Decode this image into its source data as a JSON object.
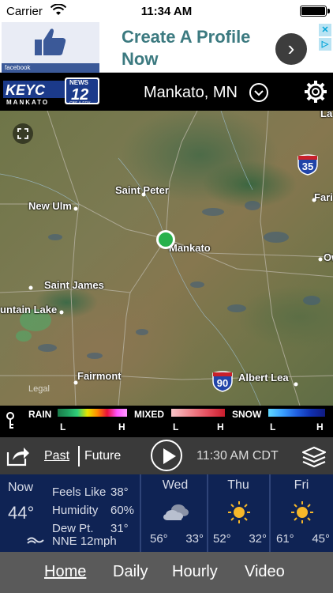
{
  "status_bar": {
    "carrier": "Carrier",
    "time": "11:34 AM"
  },
  "ad": {
    "brand": "facebook",
    "headline": "Create A Profile Now",
    "arrow": "›",
    "adchoices_icon": "adchoices-icon"
  },
  "header": {
    "logo_text": "KEYC",
    "logo_sub": "MANKATO",
    "logo_news": "NEWS",
    "logo_channel": "12",
    "logo_network": "CBS & FOX",
    "location": "Mankato, MN"
  },
  "map": {
    "labels": {
      "saint_peter": "Saint Peter",
      "new_ulm": "New Ulm",
      "mankato": "Mankato",
      "saint_james": "Saint James",
      "fountain_lake": "untain Lake",
      "fairmont": "Fairmont",
      "albert_lea": "Albert Lea",
      "la": "La",
      "fari": "Fari",
      "ow": "Ow"
    },
    "highway_35": "35",
    "highway_90": "90",
    "legal": "Legal"
  },
  "legend": {
    "rain": "RAIN",
    "mixed": "MIXED",
    "snow": "SNOW",
    "low": "L",
    "high": "H",
    "colors": {
      "rain": [
        "#1a7a4a",
        "#20a060",
        "#2fd07a",
        "#e6e600",
        "#ff8c00",
        "#e8103a",
        "#ff55ff",
        "#ff99ff"
      ],
      "mixed": [
        "#f7c4c8",
        "#f08a92",
        "#e65060",
        "#c81c2c"
      ],
      "snow": [
        "#60d8ff",
        "#3aa0ff",
        "#2060e0",
        "#1030b0",
        "#101a80"
      ]
    }
  },
  "controls": {
    "past": "Past",
    "future": "Future",
    "frame_time": "11:30 AM CDT"
  },
  "current": {
    "now_label": "Now",
    "temp": "44°",
    "feels_like_label": "Feels Like",
    "feels_like": "38°",
    "humidity_label": "Humidity",
    "humidity": "60%",
    "dew_pt_label": "Dew Pt.",
    "dew_pt": "31°",
    "wind": "NNE 12mph"
  },
  "forecast": [
    {
      "day": "Wed",
      "icon": "cloudy-icon",
      "hi": "56°",
      "lo": "33°"
    },
    {
      "day": "Thu",
      "icon": "sunny-icon",
      "hi": "52°",
      "lo": "32°"
    },
    {
      "day": "Fri",
      "icon": "sunny-icon",
      "hi": "61°",
      "lo": "45°"
    }
  ],
  "nav": {
    "home": "Home",
    "daily": "Daily",
    "hourly": "Hourly",
    "video": "Video"
  }
}
